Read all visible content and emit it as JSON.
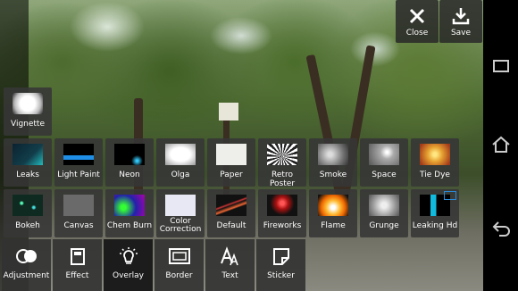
{
  "actions": {
    "close_label": "Close",
    "save_label": "Save"
  },
  "categories": {
    "vignette_label": "Vignette"
  },
  "row1": [
    "Leaks",
    "Light Paint",
    "Neon",
    "Olga",
    "Paper",
    "Retro Poster",
    "Smoke",
    "Space",
    "Tie Dye"
  ],
  "row2": [
    "Bokeh",
    "Canvas",
    "Chem Burn",
    "Color Correction",
    "Default",
    "Fireworks",
    "Flame",
    "Grunge",
    "Leaking Hd"
  ],
  "toolbar": {
    "items": [
      {
        "label": "Adjustment",
        "icon": "adjustment-icon"
      },
      {
        "label": "Effect",
        "icon": "effect-icon"
      },
      {
        "label": "Overlay",
        "icon": "overlay-icon",
        "active": true
      },
      {
        "label": "Border",
        "icon": "border-icon"
      },
      {
        "label": "Text",
        "icon": "text-icon"
      },
      {
        "label": "Sticker",
        "icon": "sticker-icon"
      }
    ]
  },
  "colors": {
    "panel": "#373737",
    "active": "#1c1c1c",
    "accent_blue": "#2a8ad6"
  }
}
